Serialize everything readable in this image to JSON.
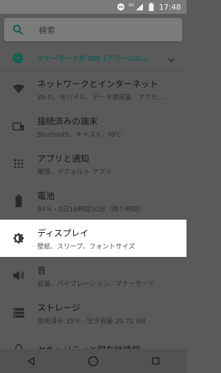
{
  "status_bar": {
    "network_label": "4G",
    "time": "17:48"
  },
  "search": {
    "placeholder": "検索"
  },
  "condition": {
    "text": "マナーモードが ON（アラームの...",
    "accent": "#0f5f57"
  },
  "settings": [
    {
      "title": "ネットワークとインターネット",
      "subtitle": "Wi-Fi、モバイル、データ使用量、アクセ...",
      "icon": "wifi-icon"
    },
    {
      "title": "接続済みの端末",
      "subtitle": "Bluetooth、キャスト、NFC",
      "icon": "devices-icon"
    },
    {
      "title": "アプリと通知",
      "subtitle": "権限、デフォルト アプリ",
      "icon": "apps-icon"
    },
    {
      "title": "電池",
      "subtitle": "84% - 5日16時間30分（残り時間）",
      "icon": "battery-icon"
    },
    {
      "title": "ディスプレイ",
      "subtitle": "壁紙、スリープ、フォントサイズ",
      "icon": "brightness-icon"
    },
    {
      "title": "音",
      "subtitle": "音量、バイブレーション、マナーモード",
      "icon": "volume-icon"
    },
    {
      "title": "ストレージ",
      "subtitle": "使用済み 35% - 空き容量 20.72 GB",
      "icon": "storage-icon"
    },
    {
      "title": "セキュリティと現在地情報",
      "subtitle": "",
      "icon": "lock-icon"
    }
  ]
}
